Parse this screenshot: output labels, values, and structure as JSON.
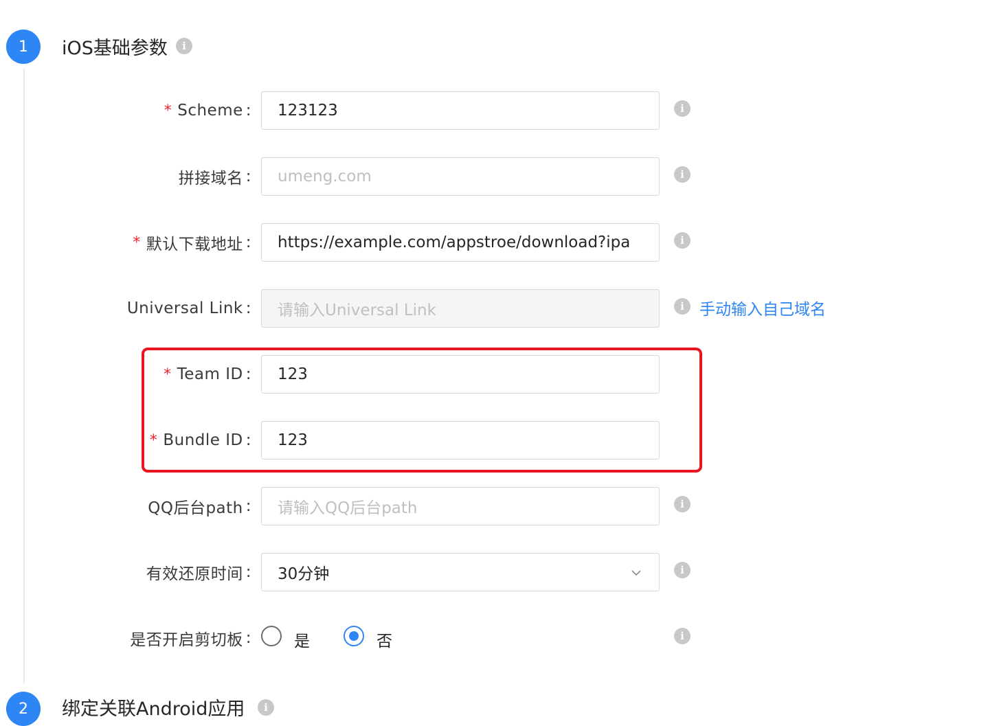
{
  "step1": {
    "number": "1",
    "title": "iOS基础参数"
  },
  "step2": {
    "number": "2",
    "title": "绑定关联Android应用"
  },
  "fields": {
    "scheme": {
      "label": "Scheme",
      "value": "123123"
    },
    "domain": {
      "label": "拼接域名",
      "placeholder": "umeng.com"
    },
    "download": {
      "label": "默认下载地址",
      "value": "https://example.com/appstroe/download?ipa"
    },
    "universal": {
      "label": "Universal Link",
      "placeholder": "请输入Universal Link",
      "link": "手动输入自己域名"
    },
    "team": {
      "label": "Team ID",
      "value": "123"
    },
    "bundle": {
      "label": "Bundle ID",
      "value": "123"
    },
    "qq": {
      "label": "QQ后台path",
      "placeholder": "请输入QQ后台path"
    },
    "restore": {
      "label": "有效还原时间",
      "value": "30分钟"
    },
    "clipboard": {
      "label": "是否开启剪切板",
      "option_yes": "是",
      "option_no": "否",
      "selected": "否"
    }
  },
  "colon": ":",
  "required_mark": "*",
  "info_glyph": "i",
  "colors": {
    "accent": "#2e86f5",
    "required": "#f5222d",
    "highlight": "#e8141f"
  }
}
